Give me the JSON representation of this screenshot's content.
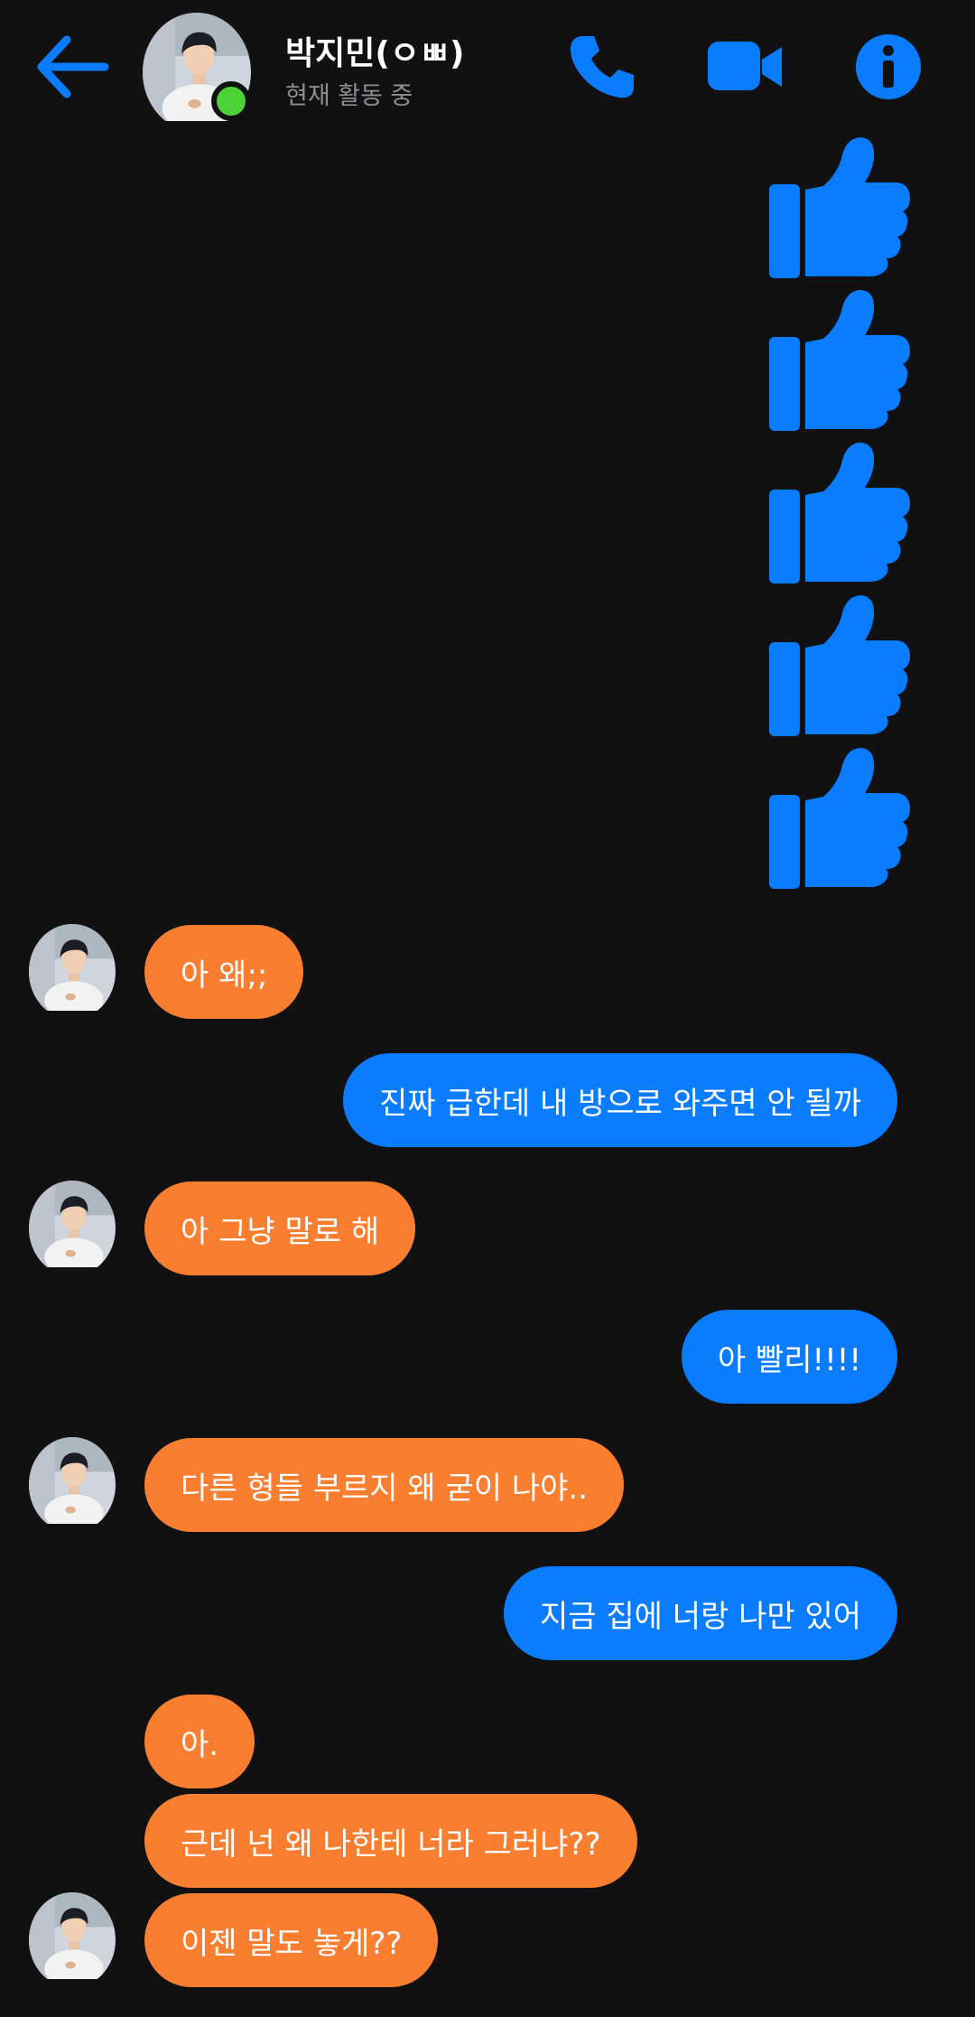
{
  "header": {
    "contact_name": "박지민(ㅇㅃ)",
    "status": "현재 활동 중",
    "back_icon": "back-arrow-icon",
    "call_icon": "phone-icon",
    "video_icon": "video-camera-icon",
    "info_icon": "info-icon",
    "online": true
  },
  "colors": {
    "background": "#111112",
    "accent": "#0a7cff",
    "outgoing_bubble": "#0a7cff",
    "incoming_bubble": "#fa7e2f",
    "online_dot": "#4cd137",
    "status_text": "#8e8e93"
  },
  "messages": [
    {
      "direction": "outgoing",
      "type": "like",
      "icon": "thumbs-up-icon"
    },
    {
      "direction": "outgoing",
      "type": "like",
      "icon": "thumbs-up-icon"
    },
    {
      "direction": "outgoing",
      "type": "like",
      "icon": "thumbs-up-icon"
    },
    {
      "direction": "outgoing",
      "type": "like",
      "icon": "thumbs-up-icon"
    },
    {
      "direction": "outgoing",
      "type": "like",
      "icon": "thumbs-up-icon"
    },
    {
      "direction": "incoming",
      "text": "아 왜;;"
    },
    {
      "direction": "outgoing",
      "text": "진짜 급한데 내 방으로 와주면 안 될까"
    },
    {
      "direction": "incoming",
      "text": "아 그냥 말로 해"
    },
    {
      "direction": "outgoing",
      "text": "아 빨리!!!!"
    },
    {
      "direction": "incoming",
      "text": "다른 형들 부르지 왜 굳이 나야.."
    },
    {
      "direction": "outgoing",
      "text": "지금 집에 너랑 나만 있어"
    },
    {
      "direction": "incoming",
      "text": "아."
    },
    {
      "direction": "incoming",
      "text": "근데 넌 왜 나한테 너라 그러냐??"
    },
    {
      "direction": "incoming",
      "text": "이젠 말도 놓게??"
    }
  ]
}
